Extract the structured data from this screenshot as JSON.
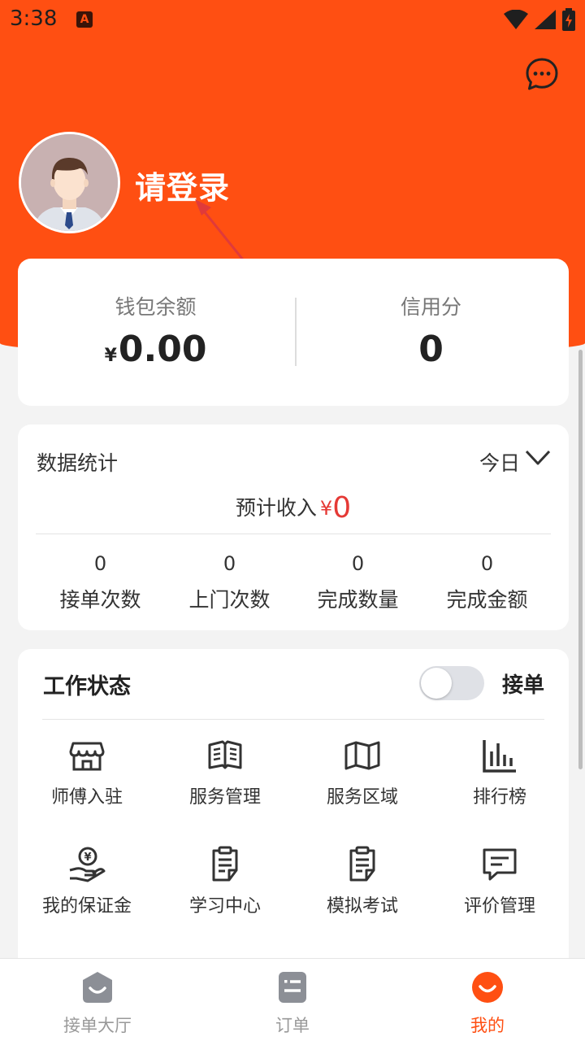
{
  "status_bar": {
    "time": "3:38",
    "notification_icon": "A"
  },
  "header": {
    "login_prompt": "请登录"
  },
  "wallet": {
    "balance_label": "钱包余额",
    "currency": "¥",
    "balance_value": "0.00",
    "credit_label": "信用分",
    "credit_value": "0"
  },
  "stats": {
    "title": "数据统计",
    "period": "今日",
    "income_label": "预计收入",
    "income_currency": "¥",
    "income_value": "0",
    "metrics": [
      {
        "value": "0",
        "label": "接单次数"
      },
      {
        "value": "0",
        "label": "上门次数"
      },
      {
        "value": "0",
        "label": "完成数量"
      },
      {
        "value": "0",
        "label": "完成金额"
      }
    ]
  },
  "work": {
    "title": "工作状态",
    "toggle_label": "接单",
    "toggle_on": false,
    "items": [
      {
        "label": "师傅入驻",
        "icon": "store-icon"
      },
      {
        "label": "服务管理",
        "icon": "book-icon"
      },
      {
        "label": "服务区域",
        "icon": "map-icon"
      },
      {
        "label": "排行榜",
        "icon": "bar-chart-icon"
      },
      {
        "label": "我的保证金",
        "icon": "deposit-hand-icon"
      },
      {
        "label": "学习中心",
        "icon": "document-icon"
      },
      {
        "label": "模拟考试",
        "icon": "exam-document-icon"
      },
      {
        "label": "评价管理",
        "icon": "comment-icon"
      }
    ]
  },
  "tabbar": {
    "tabs": [
      {
        "label": "接单大厅",
        "icon": "hall-icon",
        "active": false
      },
      {
        "label": "订单",
        "icon": "order-list-icon",
        "active": false
      },
      {
        "label": "我的",
        "icon": "profile-icon",
        "active": true
      }
    ]
  },
  "colors": {
    "brand": "#ff4f12",
    "income_red": "#e53935",
    "tab_inactive": "#999999"
  }
}
